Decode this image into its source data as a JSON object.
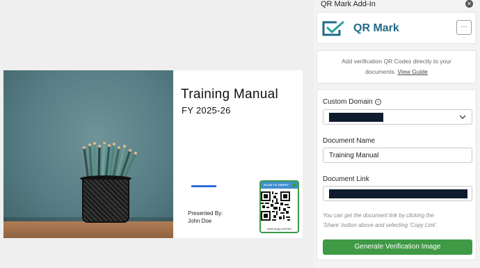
{
  "slide": {
    "title": "Training Manual",
    "subtitle": "FY 2025-26",
    "presented_by": "Presented By:",
    "presenter": "John Doe",
    "qr_badge": {
      "header": "SCAN TO VERIFY",
      "url": "loisik.qrqg.co/bGdH"
    },
    "accent_color": "#2f6fdd"
  },
  "panel": {
    "title": "QR Mark Add-In",
    "close_icon": "close-icon",
    "brand": {
      "name": "QR Mark",
      "logo_icon": "qr-mark-logo-icon",
      "more_label": "···"
    },
    "intro": {
      "line1": "Add verification QR Codes directly to your",
      "line2_prefix": "documents.",
      "view_guide": "View Guide"
    },
    "form": {
      "custom_domain_label": "Custom Domain",
      "custom_domain_info_icon": "info-icon",
      "custom_domain_value": "",
      "document_name_label": "Document Name",
      "document_name_value": "Training Manual",
      "document_link_label": "Document Link",
      "document_link_value": "",
      "hint_line1": "You can get the document link by clicking the",
      "hint_line2": "'Share' button above and selecting 'Copy Link'.",
      "generate_button": "Generate Verification Image",
      "chevron_icon": "chevron-down-icon"
    },
    "colors": {
      "brand": "#1f6b86",
      "primary_button": "#3f9a45",
      "redaction": "#0f1c2e"
    }
  }
}
